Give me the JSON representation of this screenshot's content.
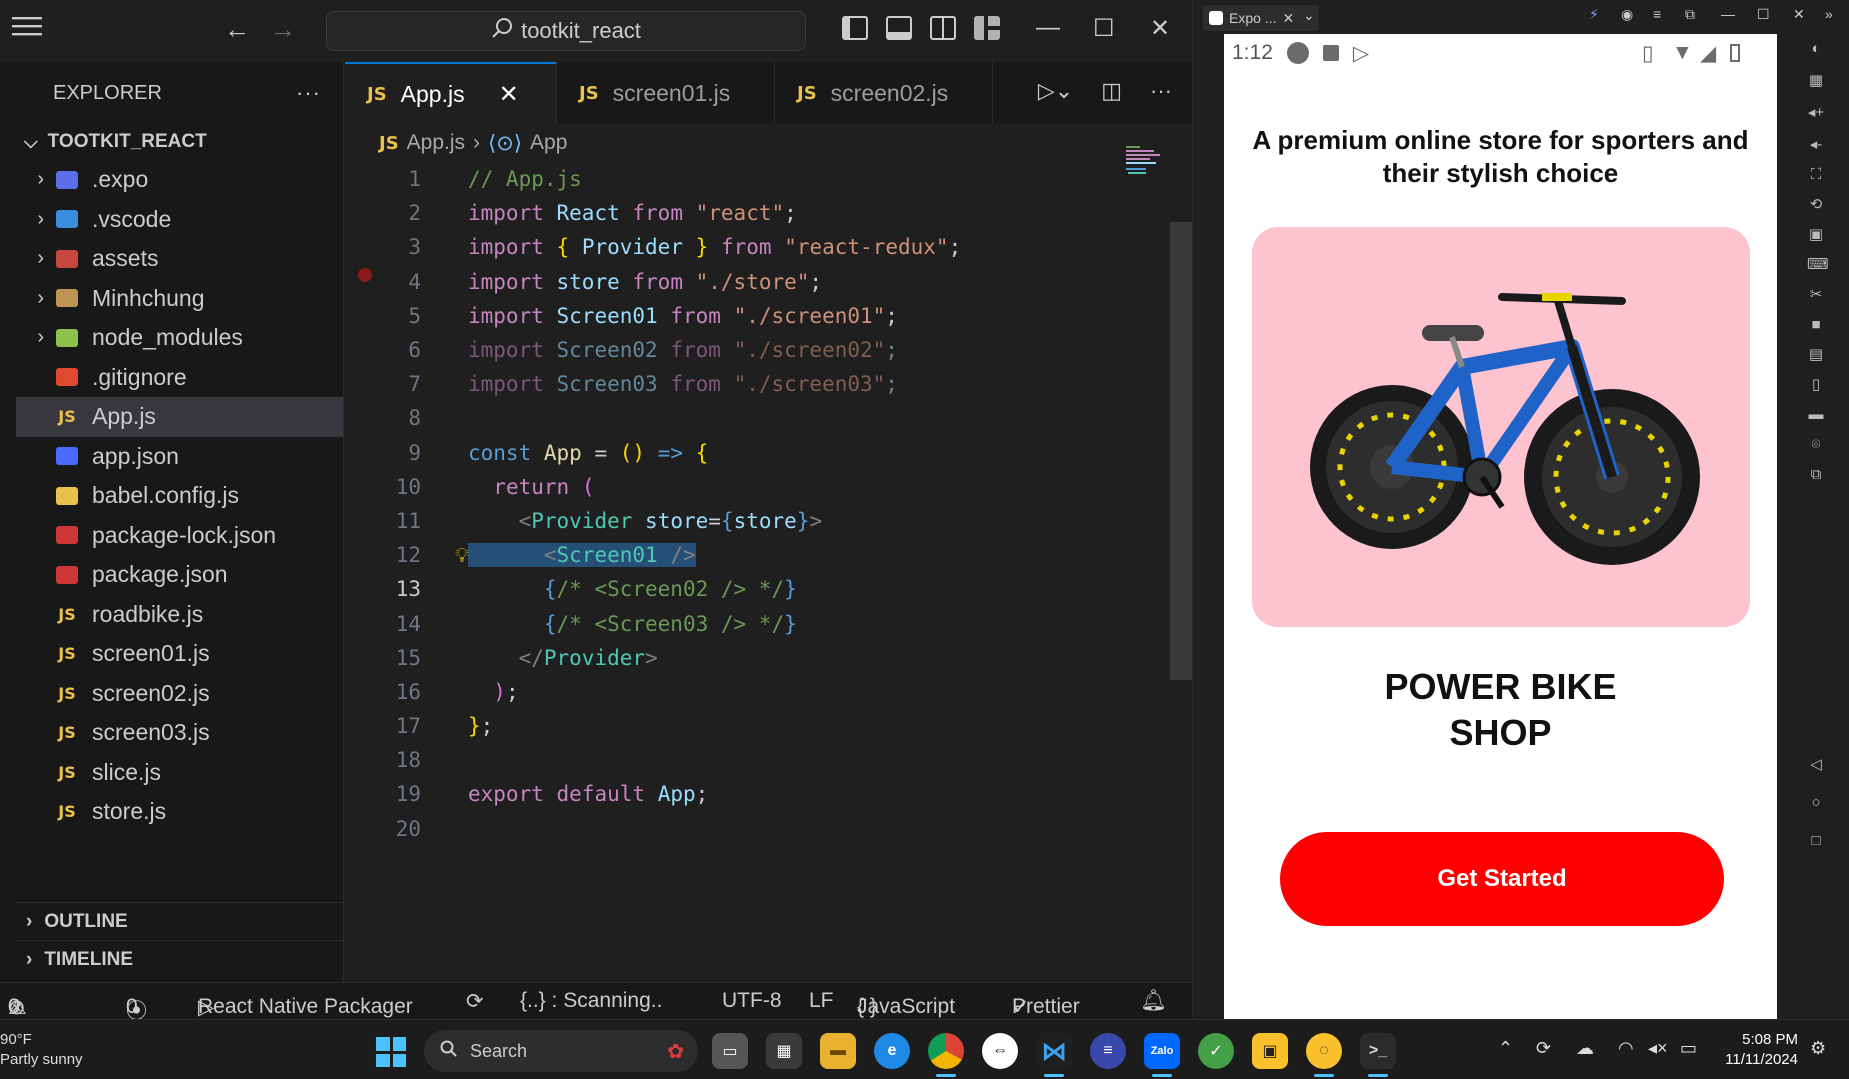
{
  "titlebar": {
    "search_text": "tootkit_react",
    "icons": [
      "menu-icon",
      "back-icon",
      "forward-icon",
      "search-icon",
      "toggle-primary-sidebar-icon",
      "toggle-panel-icon",
      "toggle-secondary-sidebar-icon",
      "customize-layout-icon",
      "minimize-icon",
      "maximize-icon",
      "close-icon"
    ]
  },
  "sidebar": {
    "title": "EXPLORER",
    "more": "···",
    "project": "TOOTKIT_REACT",
    "items": [
      {
        "label": ".expo",
        "type": "folder",
        "icon": "expo-folder-icon",
        "color": "#5a6ee6"
      },
      {
        "label": ".vscode",
        "type": "folder",
        "icon": "vscode-folder-icon",
        "color": "#3b8de0"
      },
      {
        "label": "assets",
        "type": "folder",
        "icon": "assets-folder-icon",
        "color": "#c9463d"
      },
      {
        "label": "Minhchung",
        "type": "folder",
        "icon": "folder-icon",
        "color": "#c09553"
      },
      {
        "label": "node_modules",
        "type": "folder",
        "icon": "node-folder-icon",
        "color": "#8bc34a"
      },
      {
        "label": ".gitignore",
        "type": "file",
        "icon": "git-icon",
        "color": "#e0492f"
      },
      {
        "label": "App.js",
        "type": "js",
        "icon": "js-file-icon",
        "selected": true
      },
      {
        "label": "app.json",
        "type": "file",
        "icon": "expo-file-icon",
        "color": "#4b6bff"
      },
      {
        "label": "babel.config.js",
        "type": "file",
        "icon": "babel-icon",
        "color": "#e8c24a"
      },
      {
        "label": "package-lock.json",
        "type": "file",
        "icon": "npm-icon",
        "color": "#cb3837"
      },
      {
        "label": "package.json",
        "type": "file",
        "icon": "npm-icon",
        "color": "#cb3837"
      },
      {
        "label": "roadbike.js",
        "type": "js",
        "icon": "js-file-icon"
      },
      {
        "label": "screen01.js",
        "type": "js",
        "icon": "js-file-icon"
      },
      {
        "label": "screen02.js",
        "type": "js",
        "icon": "js-file-icon"
      },
      {
        "label": "screen03.js",
        "type": "js",
        "icon": "js-file-icon"
      },
      {
        "label": "slice.js",
        "type": "js",
        "icon": "js-file-icon"
      },
      {
        "label": "store.js",
        "type": "js",
        "icon": "js-file-icon"
      }
    ],
    "js_badge": "JS",
    "outline": "OUTLINE",
    "timeline": "TIMELINE"
  },
  "editor": {
    "tabs": [
      {
        "label": "App.js",
        "active": true
      },
      {
        "label": "screen01.js",
        "active": false
      },
      {
        "label": "screen02.js",
        "active": false
      }
    ],
    "tab_close": "✕",
    "breadcrumb": {
      "file": "App.js",
      "symbol": "App"
    },
    "line_numbers": [
      "1",
      "2",
      "3",
      "4",
      "5",
      "6",
      "7",
      "8",
      "9",
      "10",
      "11",
      "12",
      "13",
      "14",
      "15",
      "16",
      "17",
      "18",
      "19",
      "20"
    ],
    "current_line": "13"
  },
  "statusbar": {
    "errors": "0",
    "warnings": "0",
    "ports": "0",
    "packager": "React Native Packager",
    "scanning": "{..} : Scanning..",
    "encoding": "UTF-8",
    "eol": "LF",
    "language": "JavaScript",
    "lang_icon": "{ }",
    "prettier": "Prettier"
  },
  "emulator": {
    "tab_label": "Expo ...",
    "time": "1:12",
    "headline": "A premium online store for sporters and their stylish choice",
    "brand_line1": "POWER BIKE",
    "brand_line2": "SHOP",
    "button_label": "Get Started",
    "accent": "#ff0000",
    "card_color": "#fdc3cf"
  },
  "taskbar": {
    "weather_temp": "90°F",
    "weather_desc": "Partly sunny",
    "search_label": "Search",
    "time": "5:08 PM",
    "date": "11/11/2024"
  }
}
